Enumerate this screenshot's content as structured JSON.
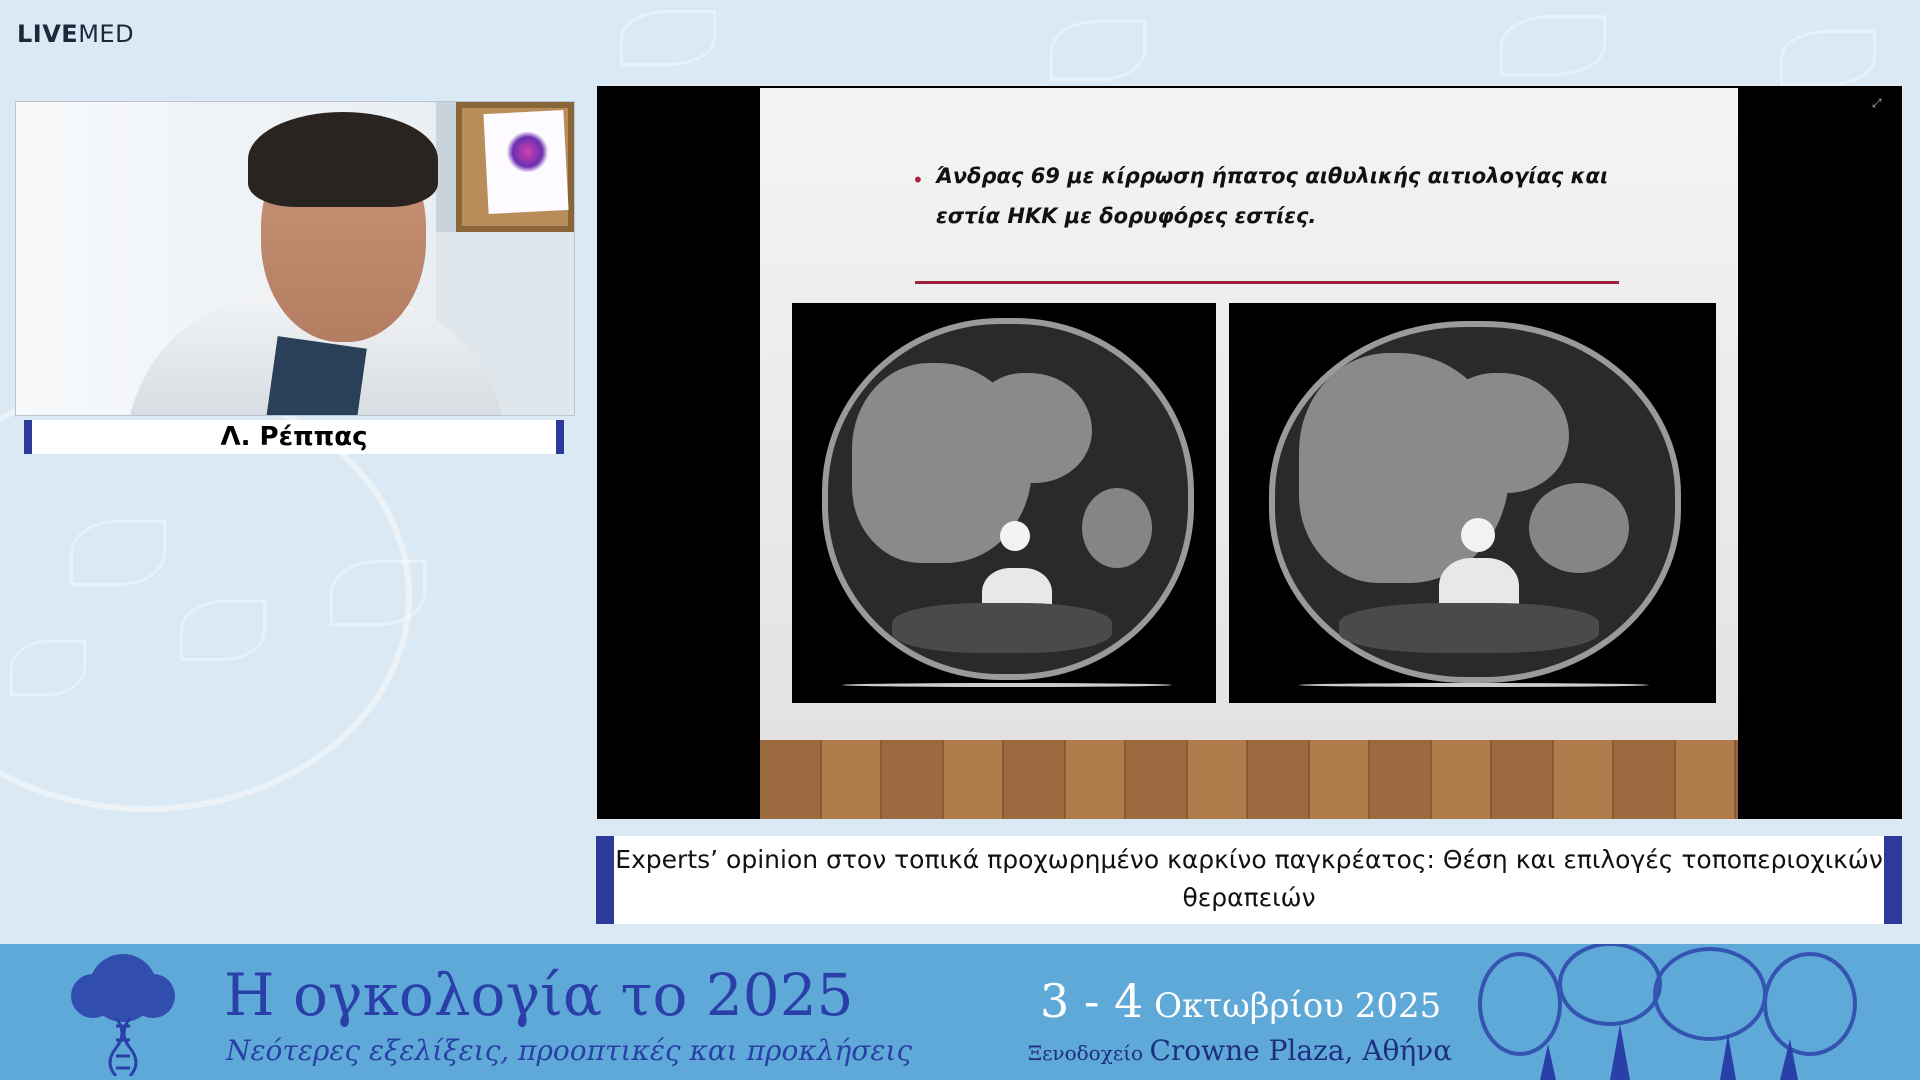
{
  "logo": {
    "bold": "LIVE",
    "light": "MED"
  },
  "speaker": {
    "name": "Λ. Ρέππας"
  },
  "slide": {
    "bullet_text": "Άνδρας 69 με κίρρωση ήπατος αιθυλικής αιτιολογίας και εστία ΗΚΚ με δορυφόρες εστίες.",
    "accent_color": "#a0203a"
  },
  "caption": {
    "text": "Experts’ opinion στον τοπικά προχωρημένο καρκίνο παγκρέατος: Θέση και επιλογές τοποπεριοχικών θεραπειών"
  },
  "banner": {
    "title": "Η ογκολογία το 2025",
    "subtitle": "Νεότερες εξελίξεις, προοπτικές και προκλήσεις",
    "date_days": "3 - 4",
    "date_rest": "Οκτωβρίου 2025",
    "venue_prefix": "Ξενοδοχείο",
    "venue_name": "Crowne Plaza",
    "venue_city": ", Αθήνα",
    "background_color": "#5fa9d8",
    "title_color": "#2a3fa8"
  },
  "icons": {
    "expand": "expand-icon"
  }
}
